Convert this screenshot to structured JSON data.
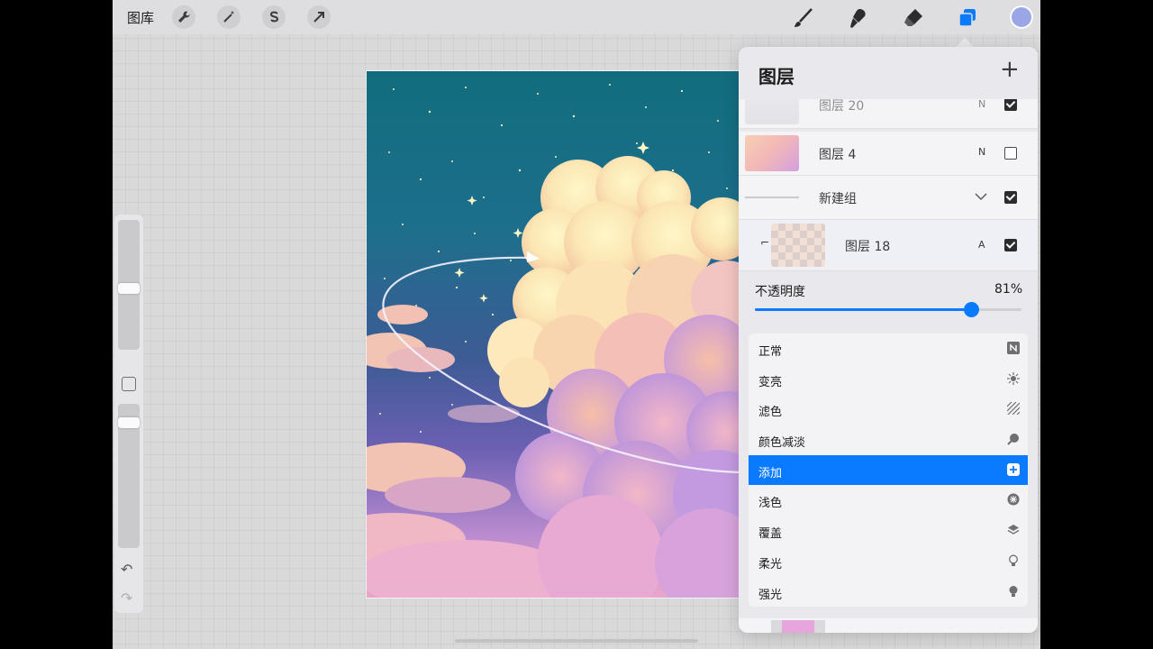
{
  "topbar": {
    "gallery_label": "图库",
    "actions": [
      {
        "name": "actions-wrench-icon"
      },
      {
        "name": "adjustments-magic-wand-icon"
      },
      {
        "name": "selection-s-icon"
      },
      {
        "name": "transform-arrow-icon"
      }
    ],
    "tools": [
      {
        "name": "brush-icon"
      },
      {
        "name": "smudge-icon"
      },
      {
        "name": "eraser-icon"
      },
      {
        "name": "layers-icon",
        "active": true
      }
    ],
    "current_color": "#9ba6e6"
  },
  "layers_panel": {
    "title": "图层",
    "layers": [
      {
        "name": "图层 20",
        "blend": "N",
        "visible": true
      },
      {
        "name": "图层 4",
        "blend": "N",
        "visible": false
      },
      {
        "name": "新建组",
        "blend": "",
        "visible": true,
        "group": true
      },
      {
        "name": "图层 18",
        "blend": "A",
        "visible": true,
        "selected": true
      }
    ],
    "opacity_label": "不透明度",
    "opacity_value": "81%",
    "opacity_fraction": 0.81,
    "blend_modes": [
      {
        "label": "正常",
        "icon": "normal-n-icon"
      },
      {
        "label": "变亮",
        "icon": "lighten-sun-icon"
      },
      {
        "label": "滤色",
        "icon": "screen-hatch-icon"
      },
      {
        "label": "颜色减淡",
        "icon": "color-dodge-icon"
      },
      {
        "label": "添加",
        "icon": "add-plus-icon",
        "selected": true
      },
      {
        "label": "浅色",
        "icon": "lighter-color-icon"
      },
      {
        "label": "覆盖",
        "icon": "overlay-layers-icon"
      },
      {
        "label": "柔光",
        "icon": "soft-light-bulb-icon"
      },
      {
        "label": "强光",
        "icon": "hard-light-bulb-icon"
      }
    ]
  },
  "colors": {
    "accent": "#0a7aff",
    "panel_bg": "#e9e9ed"
  }
}
